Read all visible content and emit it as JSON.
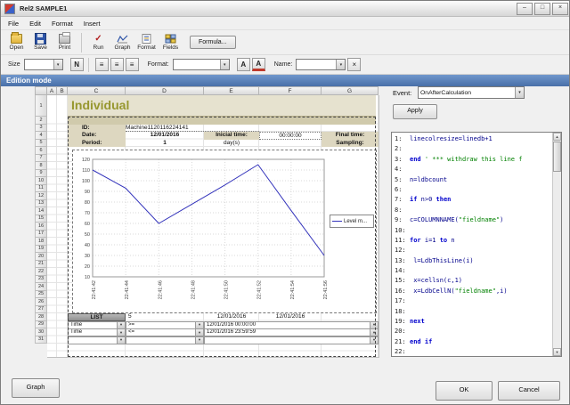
{
  "window": {
    "title": "Rel2 SAMPLE1"
  },
  "icons": {
    "dropdown": "▾",
    "close": "×",
    "run_check": "✓",
    "minimize": "–",
    "maximize": "□",
    "window_close": "×",
    "align": "≡",
    "scroll_up": "▲",
    "scroll_down": "▼"
  },
  "menu": {
    "items": [
      "File",
      "Edit",
      "Format",
      "Insert"
    ]
  },
  "toolbar": {
    "open": "Open",
    "save": "Save",
    "print": "Print",
    "run": "Run",
    "graph": "Graph",
    "format": "Format",
    "fields": "Fields",
    "formula": "Formula..."
  },
  "format_bar": {
    "size_label": "Size",
    "bold_label": "N",
    "format_label": "Format:",
    "font_label": "A",
    "name_label": "Name:"
  },
  "mode_bar": {
    "label": "Edition mode"
  },
  "sheet": {
    "column_headers": [
      "A",
      "B",
      "C",
      "D",
      "E",
      "F",
      "G"
    ],
    "row_count": 31,
    "title": "Individual",
    "fields": {
      "id_label": "ID:",
      "id_value": "Machine1120116224141",
      "date_label": "Date:",
      "date_value": "12/01/2016",
      "initial_label": "Inicial time:",
      "initial_value": "00:00:00",
      "final_label": "Final time:",
      "period_label": "Period:",
      "period_value": "1",
      "period_unit": "day(s)",
      "sampling_label": "Sampling:"
    },
    "list": {
      "button": "LIST",
      "count": "5",
      "date_left": "12/01/2016",
      "date_right": "12/01/2016",
      "rows": [
        {
          "field": "Time",
          "op": ">=",
          "value": "12/01/2016 00:00:00"
        },
        {
          "field": "Time",
          "op": "<=",
          "value": "12/01/2016 23:59:59"
        }
      ]
    }
  },
  "chart_data": {
    "type": "line",
    "title": "",
    "x_labels": [
      "22:41:42",
      "22:41:44",
      "22:41:46",
      "22:41:48",
      "22:41:50",
      "22:41:52",
      "22:41:54",
      "22:41:56"
    ],
    "series": [
      {
        "name": "Level m...",
        "color": "#3333bb",
        "values": [
          110,
          93,
          60,
          78,
          96,
          115,
          72,
          30
        ]
      }
    ],
    "ylim": [
      10,
      120
    ],
    "yticks": [
      10,
      20,
      30,
      40,
      50,
      60,
      70,
      80,
      90,
      100,
      110,
      120
    ],
    "grid": true,
    "legend_position": "right"
  },
  "event_panel": {
    "label": "Event:",
    "selected": "OnAfterCalculation",
    "apply": "Apply"
  },
  "code": {
    "lines": [
      {
        "n": "1:",
        "segs": [
          {
            "t": "linecolresize=linedb+1",
            "c": "id"
          }
        ]
      },
      {
        "n": "2:",
        "segs": []
      },
      {
        "n": "3:",
        "segs": [
          {
            "t": "end ",
            "c": "kw"
          },
          {
            "t": "' *** withdraw this line f",
            "c": "cm"
          }
        ]
      },
      {
        "n": "4:",
        "segs": []
      },
      {
        "n": "5:",
        "segs": [
          {
            "t": "n=ldbcount",
            "c": "id"
          }
        ]
      },
      {
        "n": "6:",
        "segs": []
      },
      {
        "n": "7:",
        "segs": [
          {
            "t": "if ",
            "c": "kw"
          },
          {
            "t": "n>0 ",
            "c": "id"
          },
          {
            "t": "then",
            "c": "kw"
          }
        ]
      },
      {
        "n": "8:",
        "segs": []
      },
      {
        "n": "9:",
        "segs": [
          {
            "t": "c=COLUMNNAME(",
            "c": "id"
          },
          {
            "t": "\"fieldname\"",
            "c": "st"
          },
          {
            "t": ")",
            "c": "id"
          }
        ]
      },
      {
        "n": "10:",
        "segs": []
      },
      {
        "n": "11:",
        "segs": [
          {
            "t": "for ",
            "c": "kw"
          },
          {
            "t": "i=1 ",
            "c": "id"
          },
          {
            "t": "to ",
            "c": "kw"
          },
          {
            "t": "n",
            "c": "id"
          }
        ]
      },
      {
        "n": "12:",
        "segs": []
      },
      {
        "n": "13:",
        "segs": [
          {
            "t": " l=LdbThisLine(i)",
            "c": "id"
          }
        ]
      },
      {
        "n": "14:",
        "segs": []
      },
      {
        "n": "15:",
        "segs": [
          {
            "t": " x=cellsn(c,1)",
            "c": "id"
          }
        ]
      },
      {
        "n": "16:",
        "segs": [
          {
            "t": " x=LdbCellN(",
            "c": "id"
          },
          {
            "t": "\"fieldname\"",
            "c": "st"
          },
          {
            "t": ",i)",
            "c": "id"
          }
        ]
      },
      {
        "n": "17:",
        "segs": []
      },
      {
        "n": "18:",
        "segs": []
      },
      {
        "n": "19:",
        "segs": [
          {
            "t": "next",
            "c": "kw"
          }
        ]
      },
      {
        "n": "20:",
        "segs": []
      },
      {
        "n": "21:",
        "segs": [
          {
            "t": "end if",
            "c": "kw"
          }
        ]
      },
      {
        "n": "22:",
        "segs": []
      }
    ]
  },
  "footer": {
    "graph": "Graph",
    "ok": "OK",
    "cancel": "Cancel"
  }
}
